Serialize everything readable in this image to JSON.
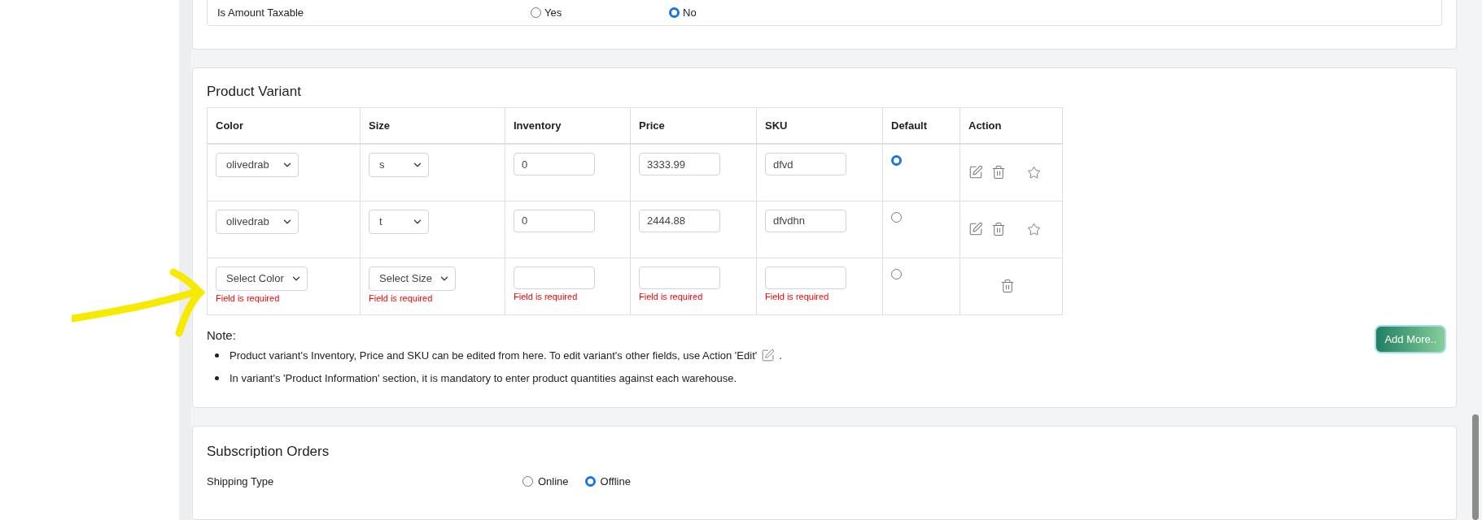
{
  "taxable": {
    "label": "Is Amount Taxable",
    "options": [
      {
        "label": "Yes",
        "selected": false
      },
      {
        "label": "No",
        "selected": true
      }
    ]
  },
  "product_variant": {
    "title": "Product Variant",
    "columns": [
      "Color",
      "Size",
      "Inventory",
      "Price",
      "SKU",
      "Default",
      "Action"
    ],
    "rows": [
      {
        "cells": [
          {
            "kind": "select",
            "value": "olivedrab"
          },
          {
            "kind": "select",
            "value": "s"
          },
          {
            "kind": "input",
            "value": "0"
          },
          {
            "kind": "input",
            "value": "3333.99"
          },
          {
            "kind": "input",
            "value": "dfvd"
          }
        ],
        "default": {
          "selected": true
        },
        "actions": [
          {
            "kind": "edit"
          },
          {
            "kind": "delete"
          },
          {
            "kind": "feature"
          }
        ]
      },
      {
        "cells": [
          {
            "kind": "select",
            "value": "olivedrab"
          },
          {
            "kind": "select",
            "value": "t"
          },
          {
            "kind": "input",
            "value": "0"
          },
          {
            "kind": "input",
            "value": "2444.88"
          },
          {
            "kind": "input",
            "value": "dfvdhn"
          }
        ],
        "default": {
          "selected": false
        },
        "actions": [
          {
            "kind": "edit"
          },
          {
            "kind": "delete"
          },
          {
            "kind": "feature"
          }
        ]
      },
      {
        "cells": [
          {
            "kind": "select",
            "value": "Select Color",
            "error": "Field is required"
          },
          {
            "kind": "select",
            "value": "Select Size",
            "error": "Field is required"
          },
          {
            "kind": "input",
            "error": "Field is required"
          },
          {
            "kind": "input",
            "error": "Field is required"
          },
          {
            "kind": "input",
            "error": "Field is required"
          }
        ],
        "default": {
          "selected": false
        },
        "actions": [
          {
            "kind": "delete"
          }
        ]
      }
    ],
    "note": {
      "title": "Note:",
      "items": [
        {
          "text": "Product variant's Inventory, Price and SKU can be edited from here. To edit variant's other fields, use Action 'Edit'",
          "kind": "with_edit_icon",
          "suffix": "."
        },
        {
          "text": "In variant's 'Product Information' section, it is mandatory to enter product quantities against each warehouse.",
          "kind": "plain"
        }
      ]
    },
    "add_button": "Add More.."
  },
  "subscription": {
    "title": "Subscription Orders",
    "fields": [
      {
        "label": "Shipping Type",
        "options": [
          {
            "label": "Online",
            "selected": false
          },
          {
            "label": "Offline",
            "selected": true
          }
        ]
      }
    ]
  }
}
